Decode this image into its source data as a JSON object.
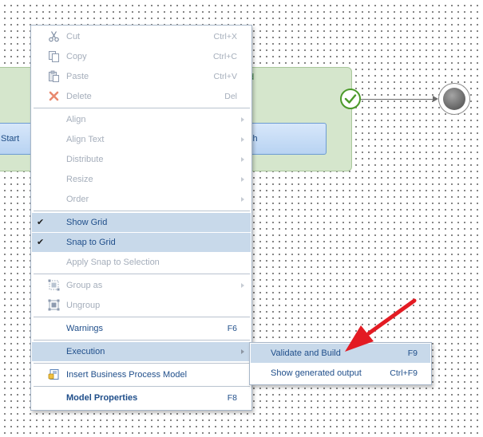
{
  "canvas": {
    "pool_title": "d",
    "task_left": "Start",
    "task_right": "sh"
  },
  "menu": {
    "cut": {
      "label": "Cut",
      "shortcut": "Ctrl+X"
    },
    "copy": {
      "label": "Copy",
      "shortcut": "Ctrl+C"
    },
    "paste": {
      "label": "Paste",
      "shortcut": "Ctrl+V"
    },
    "delete": {
      "label": "Delete",
      "shortcut": "Del"
    },
    "align": {
      "label": "Align"
    },
    "align_text": {
      "label": "Align Text"
    },
    "distribute": {
      "label": "Distribute"
    },
    "resize": {
      "label": "Resize"
    },
    "order": {
      "label": "Order"
    },
    "show_grid": {
      "label": "Show Grid",
      "checked": true
    },
    "snap_to_grid": {
      "label": "Snap to Grid",
      "checked": true
    },
    "apply_snap": {
      "label": "Apply Snap to Selection"
    },
    "group_as": {
      "label": "Group as"
    },
    "ungroup": {
      "label": "Ungroup"
    },
    "warnings": {
      "label": "Warnings",
      "shortcut": "F6"
    },
    "execution": {
      "label": "Execution"
    },
    "insert_bpm": {
      "label": "Insert Business Process Model"
    },
    "model_properties": {
      "label": "Model Properties",
      "shortcut": "F8"
    }
  },
  "submenu": {
    "validate_build": {
      "label": "Validate and Build",
      "shortcut": "F9"
    },
    "show_output": {
      "label": "Show generated output",
      "shortcut": "Ctrl+F9"
    }
  },
  "colors": {
    "menu_text": "#1f4e8a",
    "disabled_text": "#a5aebb",
    "highlight": "#c8d9ea",
    "annotation_arrow": "#e31b23",
    "pool_fill": "#d5e6cc"
  }
}
